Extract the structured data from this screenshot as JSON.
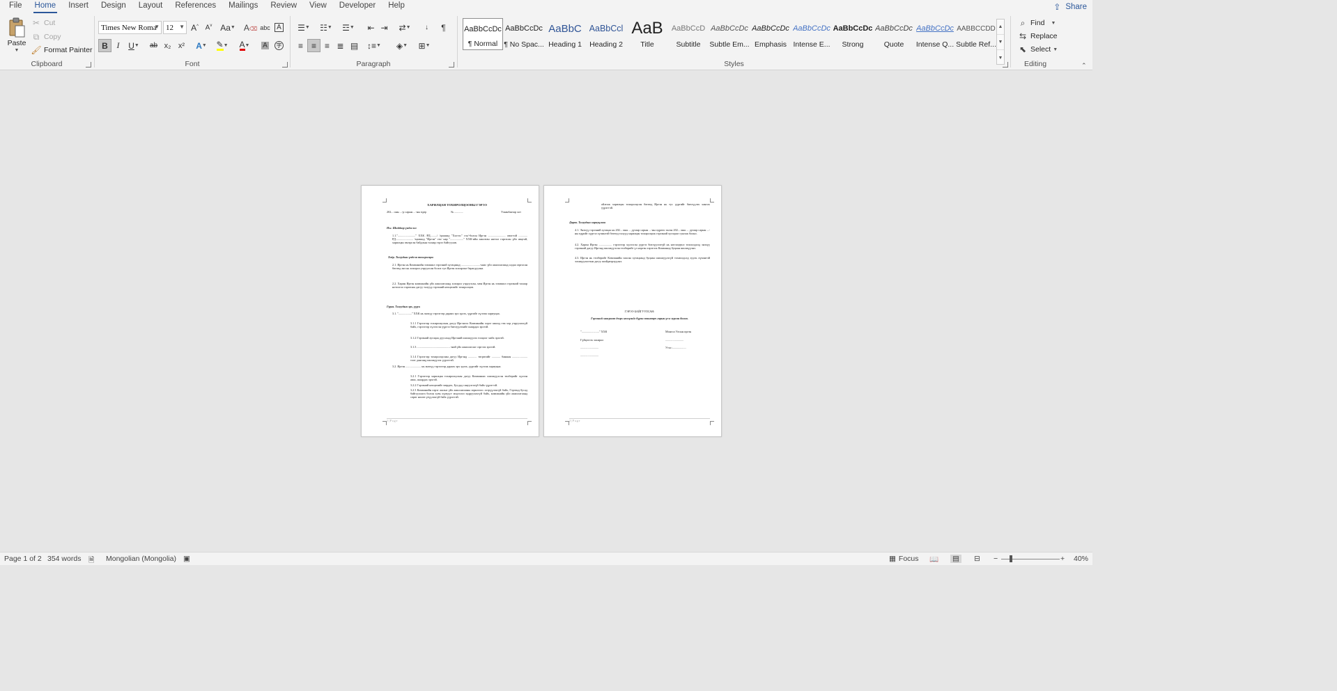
{
  "tabs": [
    "File",
    "Home",
    "Insert",
    "Design",
    "Layout",
    "References",
    "Mailings",
    "Review",
    "View",
    "Developer",
    "Help"
  ],
  "active_tab": "Home",
  "share_label": "Share",
  "clipboard": {
    "paste": "Paste",
    "cut": "Cut",
    "copy": "Copy",
    "format_painter": "Format Painter",
    "label": "Clipboard"
  },
  "font": {
    "name": "Times New Roma",
    "size": "12",
    "label": "Font",
    "bold": "B",
    "italic": "I",
    "underline": "U",
    "strike": "ab",
    "subscript": "x₂",
    "superscript": "x²",
    "change_case": "Aa",
    "grow": "A",
    "shrink": "A"
  },
  "paragraph": {
    "label": "Paragraph"
  },
  "styles": {
    "label": "Styles",
    "items": [
      {
        "preview": "AaBbCcDc",
        "name": "¶ Normal"
      },
      {
        "preview": "AaBbCcDc",
        "name": "¶ No Spac..."
      },
      {
        "preview": "AaBbC",
        "name": "Heading 1"
      },
      {
        "preview": "AaBbCcl",
        "name": "Heading 2"
      },
      {
        "preview": "AaB",
        "name": "Title"
      },
      {
        "preview": "AaBbCcD",
        "name": "Subtitle"
      },
      {
        "preview": "AaBbCcDc",
        "name": "Subtle Em..."
      },
      {
        "preview": "AaBbCcDc",
        "name": "Emphasis"
      },
      {
        "preview": "AaBbCcDc",
        "name": "Intense E..."
      },
      {
        "preview": "AaBbCcDc",
        "name": "Strong"
      },
      {
        "preview": "AaBbCcDc",
        "name": "Quote"
      },
      {
        "preview": "AaBbCcDc",
        "name": "Intense Q..."
      },
      {
        "preview": "AABBCCDD",
        "name": "Subtle Ref..."
      }
    ]
  },
  "editing": {
    "label": "Editing",
    "find": "Find",
    "replace": "Replace",
    "select": "Select"
  },
  "page1": {
    "title": "ХАРИЛЦАН ТОХИРОЛЦООНЫ ГЭРЭЭ",
    "date_line": "202... оны ...-р сарын ...-ны өдөр",
    "number_line": "№ ............",
    "city_line": "Улаанбаатар хот",
    "sec1": "Нэг. Шийдвэр үндэслэл",
    "p1_1": "1.1.\"........................\" ХХК /РД........./ /цаашид \"Хэлтэс\" гэх/-болон Иргэн ........................ овогтой ............ РД........................ /цаашид \"Иргэн\" гэх/ нар \"..................\" ХХК-ийн ажилтан нягтал гаргасан үйл явцтай, харилцан эвлэрсэн байдлын талаар гэрээ байгуулав.",
    "sec2": "Хоёр. Талуудын үндсэн тохиролцоо",
    "p2_1": "2.1. Иргэн нь Компанийн эзэмшил гэрээний хугацаанд ..........................-наас үйл ажиллагаанд алдаа гаргасан бөгөөд энэ нь хохирол учруулсан болох тул Иргэн хохирлыг барагдуулна.",
    "p2_2": "2.2. Харин Иргэн компанийн үйл ажиллагаанд хохирол учруулсан, мөн Иргэн нь эзэмшил гэрээний талаар нотолгоо гаргасны дагуу талууд гэрээний нөхцөлийг тохиролцов.",
    "sec3": "Гурав. Талуудын эрх, үүрэг",
    "p3_1": "3.1. \"..................\" ХХК нь энэхүү гэрээгээр дараах эрх эдлэх, үүргийг хүлээж хариуцна.",
    "p3_1_1": "3.1.1 Гэрээгээр тохиролцсоны дагуу Иргэнээс Компанийн хэрэг ажилд гэм хор учруулахгүй байх, гэрээгээр хүлээсэн үүргээ биелүүлэхийг шаардах эрхтэй.",
    "p3_1_2": "3.1.2 Гэрээний хугацаа дуусахад Иргэний шилжүүлэх тооцоог хийх эрхтэй.",
    "p3_1_3": "3.1.3 ..............................................-ний үйл ажиллагааг сэргээх эрхтэй.",
    "p3_1_4": "3.1.4 Гэрээгээр тохиролцсоны дагуу Иргэнд ............ төгрөгийг ............ банкны ..................... тоот дансанд шилжүүлэх үүрэгтэй.",
    "p3_2": "3.2. Иргэн ..................... нь энэхүү гэрээгээр дараах эрх эдлэх, үүргийг хүлээж хариуцна.",
    "p3_2_1": "3.2.1 Гэрээгээр харилцан тохиролцсоны дагуу Компаниас шилжүүлсэн төлбөрийг хүлээн авах, шаардах эрхтэй.",
    "p3_2_2": "3.2.2 Гэрээний нөхцөлийг мөрдөх, Бусдад сануулгагүй байх үүрэгтэй.",
    "p3_2_3": "3.2.3 Компанийн хэрэг ажлыг үйл ажиллагааны зорилгоос хэтрүүлэхгүй байх, Гэрээнд бусад байгууллага болон хувь хүмүүст мэдээлэл задруулахгүй байх, компанийн үйл ажиллагаанд сөрөг нөлөө үзүүлэхгүй байх үүрэгтэй.",
    "footer": "1 | P a g e"
  },
  "page2": {
    "top_text": "ойлгож харилцан тохиролцсон бөгөөд Иргэн нь тус үүргийг биелүүлэх хангах үүрэгтэй.",
    "sec4": "Дөрөв. Талуудын хариуцлага",
    "p4_1": "4.1. Энэхүү гэрээний хугацаа нь 202... оны ... дугаар сарын ...-ны өдрөөс эхлэн 202... оны ... дугаар сарын ...-ны өдрийг хүртэл хүчинтэй бөгөөд талууд харилцан тохиролцож гэрээний хугацааг сунгаж болно.",
    "p4_2": "4.2. Харин Иргэн .................. гэрээгээр хүлээсэн үүргээ биелүүлээгүй нь нотлогдвол тохиолдолд энэхүү гэрээний дагуу Иргэнд шилжүүлсэн төлбөрийг үл нэргэн хэрэглэх Компанид буцаан шилжүүлнэ.",
    "p4_3": "4.3. Иргэн нь төлбөрийг Компанийн заасан хугацаанд буцаан шилжүүлэгүй тохиолдолд хууль хүчинтэй зохицуулалтын дагуу шийдвэрлүүлнэ.",
    "sign_title": "ГЭРЭЭ БАЙГУУЛСАН:",
    "sign_sub": "Гэрээний хавсралт дээрх нөхцлийг бүрэн зөвшөөрч гарын үсэг зурсан болно.",
    "left1": "\"........................\" ХХК",
    "left2": "Гүйцэтгэх захирал",
    "left3": ".........................",
    "left4": ".........................",
    "right1": "Монгол Улсын иргэн",
    "right2": ".........................",
    "right3": "Утас:...................",
    "footer": "2 | P a g e"
  },
  "status": {
    "page": "Page 1 of 2",
    "words": "354 words",
    "language": "Mongolian (Mongolia)",
    "focus": "Focus",
    "zoom": "40%"
  }
}
